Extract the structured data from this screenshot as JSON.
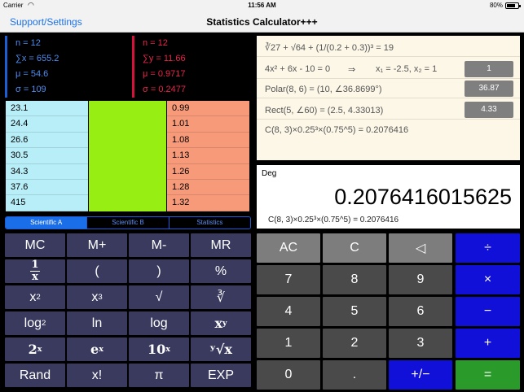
{
  "status": {
    "carrier": "Carrier",
    "time": "11:56 AM",
    "battery": "80%",
    "battery_level": 0.8
  },
  "nav": {
    "back_label": "Support/Settings",
    "title": "Statistics Calculator+++"
  },
  "stats_x": [
    "n = 12",
    "∑x = 655.2",
    "μ = 54.6",
    "σ = 109"
  ],
  "stats_y": [
    "n = 12",
    "∑y = 11.66",
    "μ = 0.9717",
    "σ = 0.2477"
  ],
  "x_values": [
    "23.1",
    "24.4",
    "26.6",
    "30.5",
    "34.3",
    "37.6",
    "415"
  ],
  "y_values": [
    "0.99",
    "1.01",
    "1.08",
    "1.13",
    "1.26",
    "1.28",
    "1.32"
  ],
  "tabs": [
    "Scientific A",
    "Scientific B",
    "Statistics"
  ],
  "history": [
    {
      "expr": "∛27 + √64 + (1/(0.2 + 0.3))³ = 19"
    },
    {
      "expr": "4x² + 6x - 10 = 0",
      "arrow": "⇒",
      "roots": "x₁ = -2.5, x₂ = 1",
      "value": "1"
    },
    {
      "expr": "Polar(8, 6) = (10, ∠36.8699°)",
      "value": "36.87"
    },
    {
      "expr": "Rect(5, ∠60) = (2.5, 4.33013)",
      "value": "4.33"
    },
    {
      "expr": "C(8, 3)×0.25³×(0.75^5) = 0.2076416"
    }
  ],
  "display": {
    "mode": "Deg",
    "result": "0.2076416015625",
    "expression": "C(8, 3)×0.25³×(0.75^5) = 0.2076416"
  },
  "sci_keys": {
    "mc": "MC",
    "mplus": "M+",
    "mminus": "M-",
    "mr": "MR",
    "recip_num": "1",
    "recip_den": "x",
    "lparen": "(",
    "rparen": ")",
    "percent": "%",
    "square_base": "x",
    "square_exp": "2",
    "cube_base": "x",
    "cube_exp": "3",
    "sqrt": "√",
    "cbrt": "∛",
    "log2_base": "log",
    "log2_sub": "2",
    "ln": "ln",
    "log": "log",
    "xy_base": "x",
    "xy_exp": "y",
    "pow2_base": "2",
    "pow2_exp": "x",
    "exp_base": "e",
    "exp_exp": "x",
    "pow10_base": "10",
    "pow10_exp": "x",
    "yroot": "ʸ√x",
    "rand": "Rand",
    "fact": "x!",
    "pi": "π",
    "exp": "EXP"
  },
  "num_keys": {
    "ac": "AC",
    "c": "C",
    "back": "◁",
    "divide": "÷",
    "7": "7",
    "8": "8",
    "9": "9",
    "multiply": "×",
    "4": "4",
    "5": "5",
    "6": "6",
    "minus": "−",
    "1": "1",
    "2": "2",
    "3": "3",
    "plus": "+",
    "0": "0",
    "dot": ".",
    "sign": "+/−",
    "equals": "="
  },
  "colors": {
    "accent_blue": "#1010d8",
    "equals_green": "#2a9a2a",
    "x_series": "#1a5fd6",
    "y_series": "#d6123a"
  }
}
